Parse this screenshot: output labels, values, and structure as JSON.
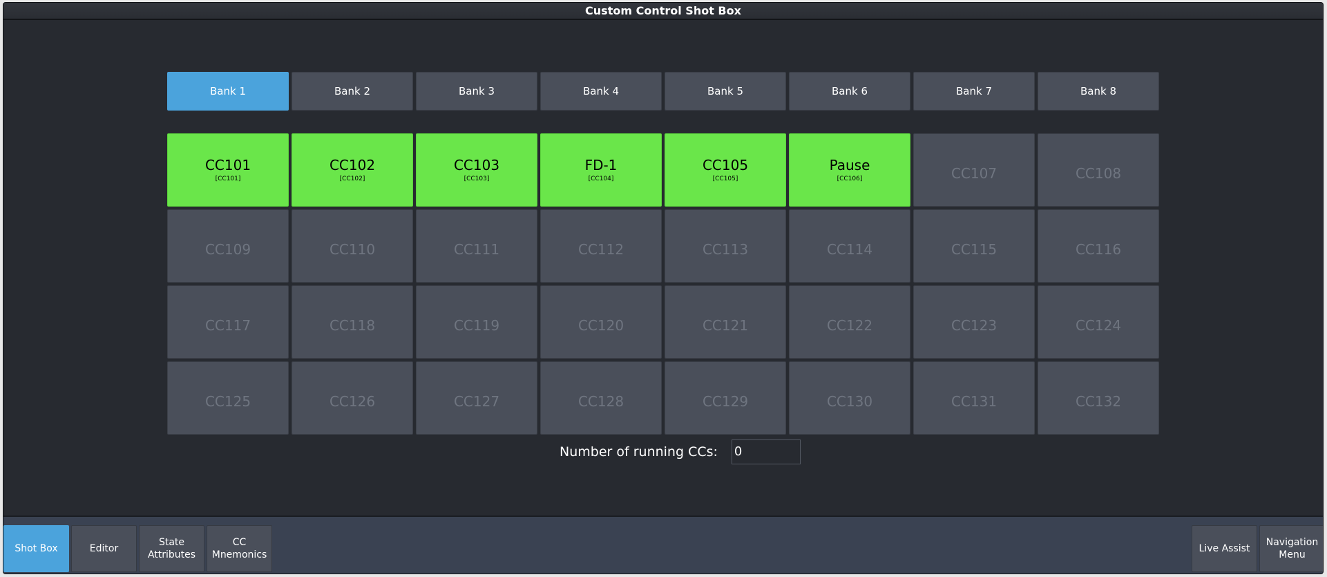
{
  "window": {
    "title": "Custom Control Shot Box"
  },
  "banks": [
    {
      "label": "Bank 1",
      "active": true
    },
    {
      "label": "Bank 2",
      "active": false
    },
    {
      "label": "Bank 3",
      "active": false
    },
    {
      "label": "Bank 4",
      "active": false
    },
    {
      "label": "Bank 5",
      "active": false
    },
    {
      "label": "Bank 6",
      "active": false
    },
    {
      "label": "Bank 7",
      "active": false
    },
    {
      "label": "Bank 8",
      "active": false
    }
  ],
  "custom_controls": [
    {
      "label": "CC101",
      "sub": "[CC101]",
      "active": true
    },
    {
      "label": "CC102",
      "sub": "[CC102]",
      "active": true
    },
    {
      "label": "CC103",
      "sub": "[CC103]",
      "active": true
    },
    {
      "label": "FD-1",
      "sub": "[CC104]",
      "active": true
    },
    {
      "label": "CC105",
      "sub": "[CC105]",
      "active": true
    },
    {
      "label": "Pause",
      "sub": "[CC106]",
      "active": true
    },
    {
      "label": "CC107",
      "sub": "",
      "active": false
    },
    {
      "label": "CC108",
      "sub": "",
      "active": false
    },
    {
      "label": "CC109",
      "sub": "",
      "active": false
    },
    {
      "label": "CC110",
      "sub": "",
      "active": false
    },
    {
      "label": "CC111",
      "sub": "",
      "active": false
    },
    {
      "label": "CC112",
      "sub": "",
      "active": false
    },
    {
      "label": "CC113",
      "sub": "",
      "active": false
    },
    {
      "label": "CC114",
      "sub": "",
      "active": false
    },
    {
      "label": "CC115",
      "sub": "",
      "active": false
    },
    {
      "label": "CC116",
      "sub": "",
      "active": false
    },
    {
      "label": "CC117",
      "sub": "",
      "active": false
    },
    {
      "label": "CC118",
      "sub": "",
      "active": false
    },
    {
      "label": "CC119",
      "sub": "",
      "active": false
    },
    {
      "label": "CC120",
      "sub": "",
      "active": false
    },
    {
      "label": "CC121",
      "sub": "",
      "active": false
    },
    {
      "label": "CC122",
      "sub": "",
      "active": false
    },
    {
      "label": "CC123",
      "sub": "",
      "active": false
    },
    {
      "label": "CC124",
      "sub": "",
      "active": false
    },
    {
      "label": "CC125",
      "sub": "",
      "active": false
    },
    {
      "label": "CC126",
      "sub": "",
      "active": false
    },
    {
      "label": "CC127",
      "sub": "",
      "active": false
    },
    {
      "label": "CC128",
      "sub": "",
      "active": false
    },
    {
      "label": "CC129",
      "sub": "",
      "active": false
    },
    {
      "label": "CC130",
      "sub": "",
      "active": false
    },
    {
      "label": "CC131",
      "sub": "",
      "active": false
    },
    {
      "label": "CC132",
      "sub": "",
      "active": false
    }
  ],
  "running": {
    "label": "Number of running CCs:",
    "value": "0"
  },
  "footer": {
    "left_buttons": [
      {
        "label": "Shot Box",
        "active": true
      },
      {
        "label": "Editor",
        "active": false
      },
      {
        "label": "State\nAttributes",
        "active": false
      },
      {
        "label": "CC\nMnemonics",
        "active": false
      }
    ],
    "right_buttons": [
      {
        "label": "Live Assist",
        "active": false
      },
      {
        "label": "Navigation\nMenu",
        "active": false
      }
    ]
  },
  "colors": {
    "accent": "#4ba3dc",
    "cc_active": "#6ae64a",
    "background": "#272a30",
    "button": "#4a4f5a"
  }
}
